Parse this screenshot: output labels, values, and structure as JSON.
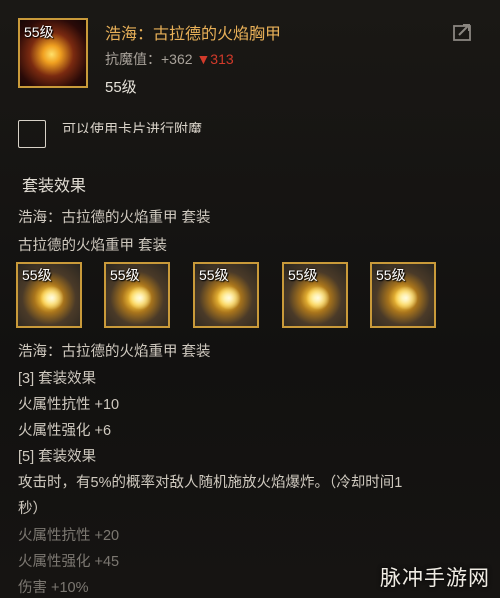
{
  "item": {
    "level_badge": "55级",
    "name": "浩海：古拉德的火焰胸甲",
    "stat_label": "抗魔值：+362",
    "stat_down": "▼313",
    "level": "55级"
  },
  "card_option": "可以使用卡片进行附魔",
  "set": {
    "section_title": "套装效果",
    "line1": "浩海：古拉德的火焰重甲  套装",
    "line2": "古拉德的火焰重甲  套装",
    "slots": [
      "55级",
      "55级",
      "55级",
      "55级",
      "55级"
    ],
    "line3": "浩海：古拉德的火焰重甲 套装",
    "bonus3_header": "[3] 套装效果",
    "bonus3_a": "火属性抗性 +10",
    "bonus3_b": "火属性强化 +6",
    "bonus5_header": "[5] 套装效果",
    "bonus5_text1": "攻击时，有5%的概率对敌人随机施放火焰爆炸。（冷却时间1",
    "bonus5_text2": "秒）",
    "bonus5_a": "火属性抗性 +20",
    "bonus5_b": "火属性强化 +45",
    "bonus5_c": "伤害 +10%"
  },
  "watermark": "脉冲手游网",
  "colors": {
    "item_name": "#e8b058",
    "stat_down": "#d23a2a",
    "border_gold": "#c99a3a"
  }
}
